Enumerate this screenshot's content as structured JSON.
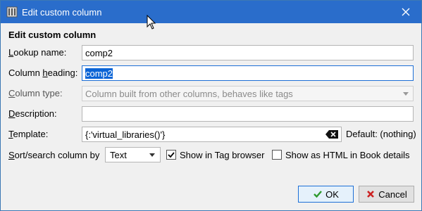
{
  "window": {
    "title": "Edit custom column",
    "icon": "library-icon",
    "close_icon": "close-icon"
  },
  "form": {
    "heading": "Edit custom column",
    "lookup_name": {
      "label_u": "L",
      "label_rest": "ookup name:",
      "value": "comp2"
    },
    "column_heading": {
      "label_pre": "Column ",
      "label_u": "h",
      "label_rest": "eading:",
      "value": "comp2"
    },
    "column_type": {
      "label_u": "C",
      "label_rest": "olumn type:",
      "value": "Column built from other columns, behaves like tags"
    },
    "description": {
      "label_u": "D",
      "label_rest": "escription:",
      "value": ""
    },
    "template": {
      "label_u": "T",
      "label_rest": "emplate:",
      "value": "{:'virtual_libraries()'}",
      "default_text": "Default: (nothing)"
    },
    "sort": {
      "label_u": "S",
      "label_rest": "ort/search column by",
      "value": "Text"
    },
    "show_in_tag_browser": {
      "label": "Show in Tag browser",
      "checked": true
    },
    "show_as_html": {
      "label": "Show as HTML in Book details",
      "checked": false
    }
  },
  "buttons": {
    "ok": "OK",
    "cancel": "Cancel"
  },
  "colors": {
    "titlebar": "#2a6dcb",
    "selection": "#0a64d6",
    "ok_check": "#2e9a2e",
    "cancel_x": "#cc2222"
  }
}
